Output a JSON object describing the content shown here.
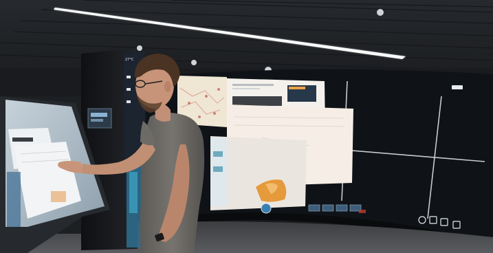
{
  "scene": {
    "description_text": "",
    "wall_header": {
      "title_line1": "",
      "title_line2": ""
    },
    "kiosk_readout": "27°C",
    "room_colors": {
      "ceiling": "#2a2d31",
      "wall": "#1a1c1e",
      "floor": "#4d4f52",
      "screen_grid_bg": "#101418",
      "screen_grid_line": "#e8ecef",
      "map_paper": "#f2ede6",
      "accent_orange": "#e59a3b",
      "shirt": "#6d6b67",
      "skin": "#c79479",
      "hair": "#4a3322"
    },
    "icons": [
      "ceiling-light-icon",
      "camera-icon",
      "person-silhouette",
      "touch-table-icon"
    ]
  }
}
